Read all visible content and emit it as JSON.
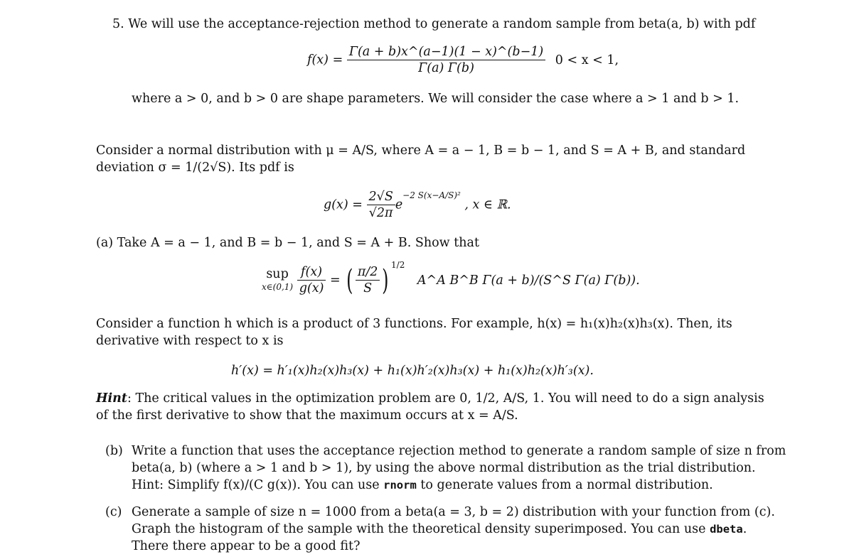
{
  "problem": {
    "number": "5.",
    "intro": "We will use the acceptance-rejection method to generate a random sample from beta(a, b) with pdf",
    "pdf_f": {
      "lhs": "f(x) =",
      "numerator": "Γ(a + b)x^(a−1)(1 − x)^(b−1)",
      "denominator": "Γ(a) Γ(b)",
      "domain": "0 < x < 1,"
    },
    "shape_note": "where a > 0, and b > 0 are shape parameters. We will consider the case where a > 1 and b > 1."
  },
  "normal": {
    "line1": "Consider a normal distribution with μ = A/S, where A = a − 1, B = b − 1, and S = A + B, and standard",
    "line2": "deviation σ = 1/(2√S). Its pdf is",
    "pdf_g": {
      "lhs": "g(x) =",
      "numerator": "2√S",
      "denominator": "√2π",
      "exponent": "−2 S(x−A/S)²",
      "domain": ", x ∈ ℝ."
    }
  },
  "part_a": {
    "label": "(a)",
    "text": "Take A = a − 1, and B = b − 1, and S = A + B. Show that",
    "sup_formula": {
      "op": "sup",
      "op_sub": "x∈(0,1)",
      "ratio_num": "f(x)",
      "ratio_den": "g(x)",
      "paren_num": "π/2",
      "paren_den": "S",
      "power": "1/2",
      "rest": "A^A B^B Γ(a + b)/(S^S Γ(a) Γ(b))."
    }
  },
  "product_rule": {
    "line1": "Consider a function h which is a product of 3 functions. For example, h(x) = h₁(x)h₂(x)h₃(x). Then, its",
    "line2": "derivative with respect to x is",
    "formula": "h′(x) = h′₁(x)h₂(x)h₃(x) + h₁(x)h′₂(x)h₃(x) + h₁(x)h₂(x)h′₃(x)."
  },
  "hint": {
    "label": "Hint",
    "line1": ": The critical values in the optimization problem are 0, 1/2, A/S, 1. You will need to do a sign analysis",
    "line2": "of the first derivative to show that the maximum occurs at x = A/S."
  },
  "part_b": {
    "label": "(b)",
    "line1": "Write a function that uses the acceptance rejection method to generate a random sample of size n from",
    "line2": "beta(a, b) (where a > 1 and b > 1), by using the above normal distribution as the trial distribution.",
    "line3_pre": "Hint: Simplify f(x)/(C g(x)). You can use",
    "code": "rnorm",
    "line3_post": "to generate values from a normal distribution."
  },
  "part_c": {
    "label": "(c)",
    "line1": "Generate a sample of size n = 1000 from a beta(a = 3, b = 2) distribution with your function from (c).",
    "line2_pre": "Graph the histogram of the sample with the theoretical density superimposed. You can use",
    "code": "dbeta",
    "line2_post": ".",
    "line3": "There there appear to be a good fit?"
  }
}
